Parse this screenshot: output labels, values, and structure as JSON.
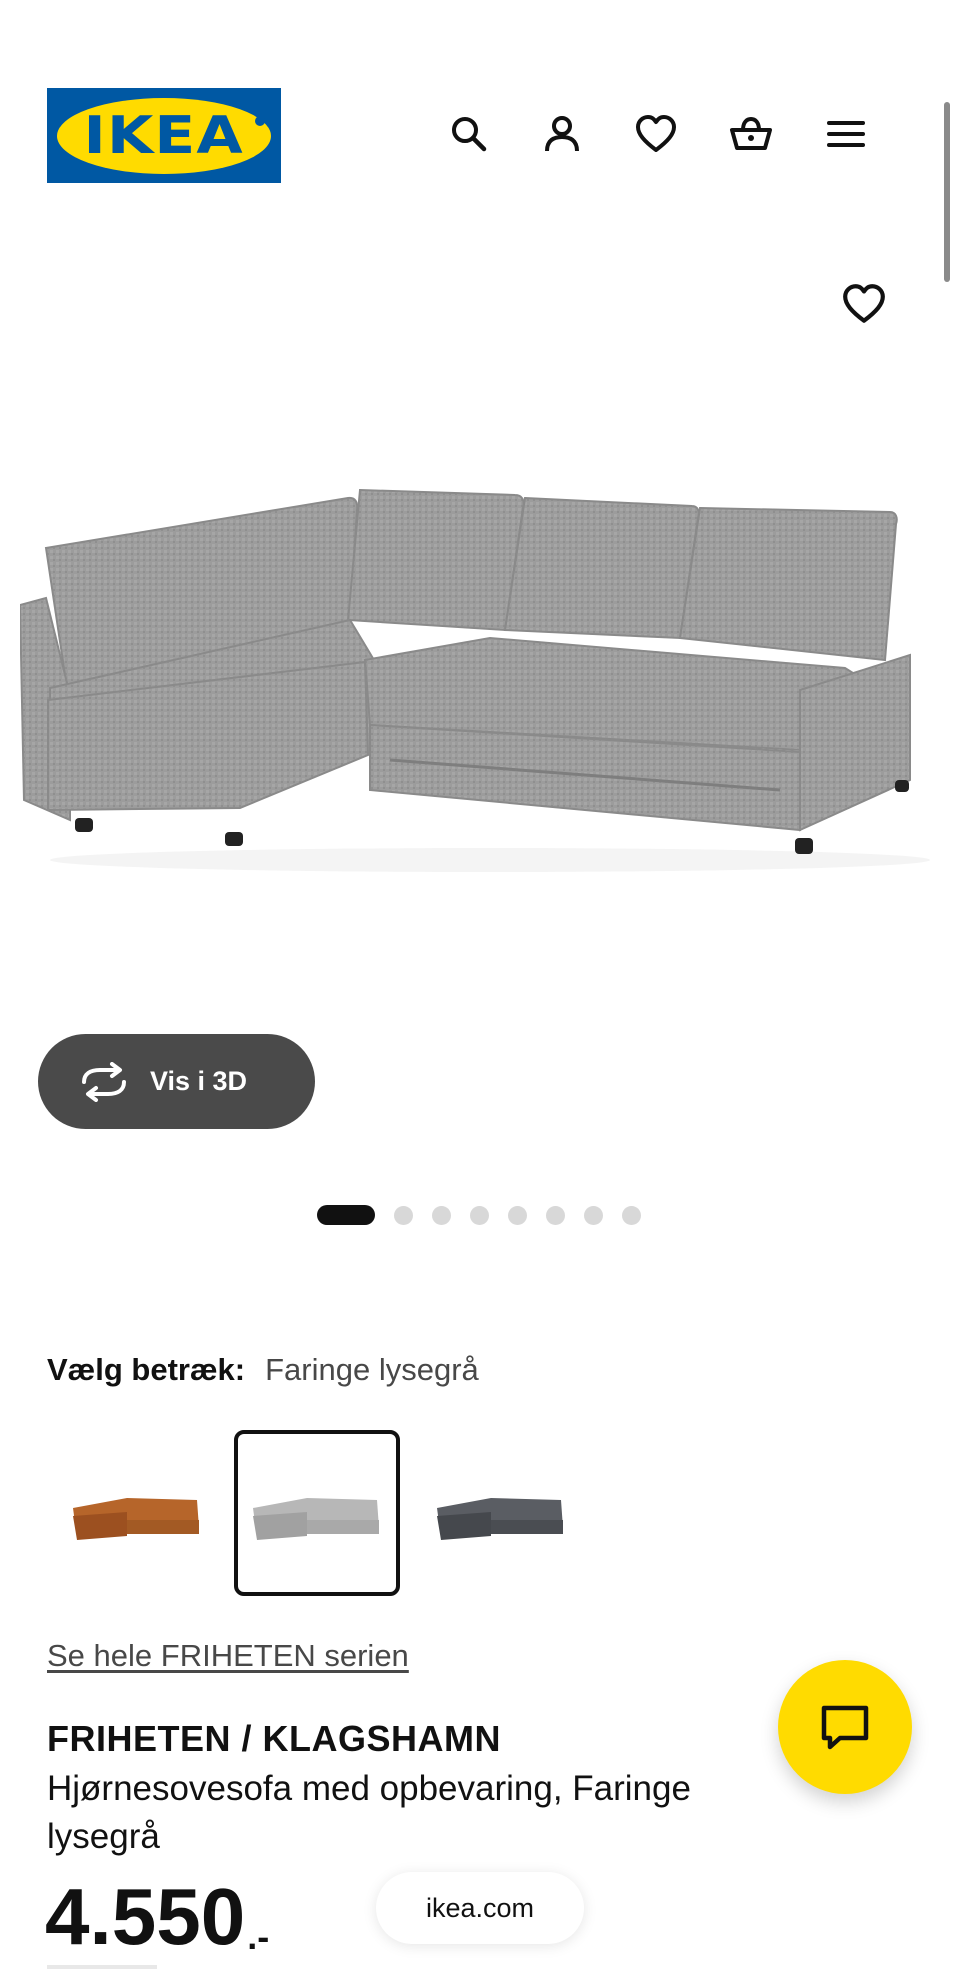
{
  "brand": {
    "logo_text": "IKEA",
    "logo_blue": "#0058a3",
    "logo_yellow": "#ffdb00"
  },
  "header": {
    "icons": [
      "search-icon",
      "user-icon",
      "heart-icon",
      "basket-icon",
      "menu-icon"
    ]
  },
  "gallery": {
    "view_3d_label": "Vis i 3D",
    "image_count": 8,
    "active_index": 0
  },
  "cover": {
    "label": "Vælg betræk:",
    "selected": "Faringe lysegrå",
    "swatch_colors": [
      "#b6652a",
      "#a9a9a9",
      "#4a4d52"
    ],
    "selected_index": 1
  },
  "series_link": "Se hele FRIHETEN serien",
  "product": {
    "name": "FRIHETEN / KLAGSHAMN",
    "description": "Hjørnesovesofa med opbevaring, Faringe lysegrå",
    "price": "4.550",
    "price_suffix": ".-"
  },
  "browser": {
    "url": "ikea.com"
  },
  "colors": {
    "accent_yellow": "#ffdb00",
    "dark_button": "#4a4a4a"
  }
}
